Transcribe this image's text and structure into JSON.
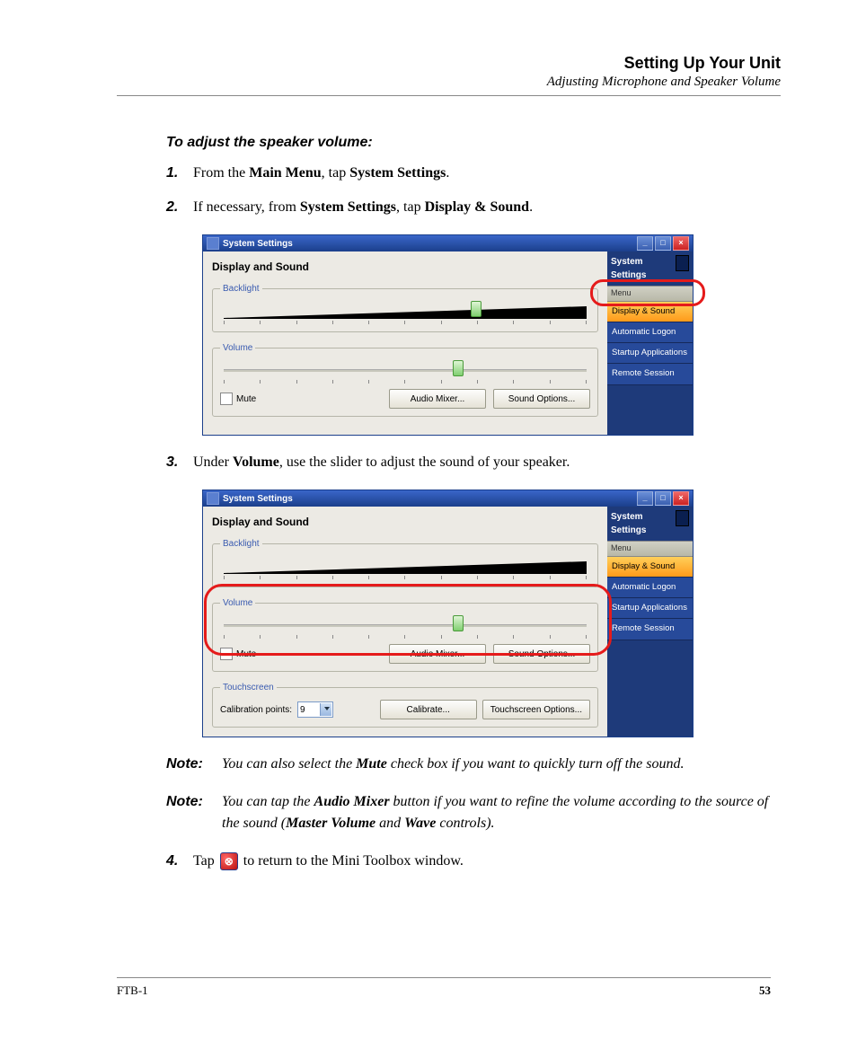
{
  "header": {
    "title": "Setting Up Your Unit",
    "subtitle": "Adjusting Microphone and Speaker Volume"
  },
  "section_title": "To adjust the speaker volume:",
  "steps": {
    "s1": {
      "num": "1.",
      "pre": "From the ",
      "b1": "Main Menu",
      "mid": ", tap ",
      "b2": "System Settings",
      "post": "."
    },
    "s2": {
      "num": "2.",
      "pre": "If necessary, from ",
      "b1": "System Settings",
      "mid": ", tap ",
      "b2": "Display & Sound",
      "post": "."
    },
    "s3": {
      "num": "3.",
      "pre": "Under ",
      "b1": "Volume",
      "post": ", use the slider to adjust the sound of your speaker."
    },
    "s4": {
      "num": "4.",
      "pre": "Tap ",
      "post": " to return to the Mini Toolbox window."
    }
  },
  "notes": {
    "label": "Note:",
    "n1": {
      "pre": "You can also select the ",
      "b1": "Mute",
      "post": " check box if you want to quickly turn off the sound."
    },
    "n2": {
      "pre": "You can tap the ",
      "b1": "Audio Mixer",
      "mid1": " button if you want to refine the volume according to the source of the sound (",
      "b2": "Master Volume",
      "mid2": " and ",
      "b3": "Wave",
      "post": " controls)."
    }
  },
  "win": {
    "title": "System Settings",
    "panel_title": "Display and Sound",
    "backlight_label": "Backlight",
    "volume_label": "Volume",
    "mute_label": "Mute",
    "audio_mixer_btn": "Audio Mixer...",
    "sound_options_btn": "Sound Options...",
    "touchscreen_label": "Touchscreen",
    "calib_points_label": "Calibration points:",
    "calib_points_value": "9",
    "calibrate_btn": "Calibrate...",
    "touch_options_btn": "Touchscreen Options...",
    "side_title": "System Settings",
    "side_menu": "Menu",
    "side_items": [
      "Display & Sound",
      "Automatic Logon",
      "Startup Applications",
      "Remote Session"
    ]
  },
  "footer": {
    "left": "FTB-1",
    "right": "53"
  }
}
